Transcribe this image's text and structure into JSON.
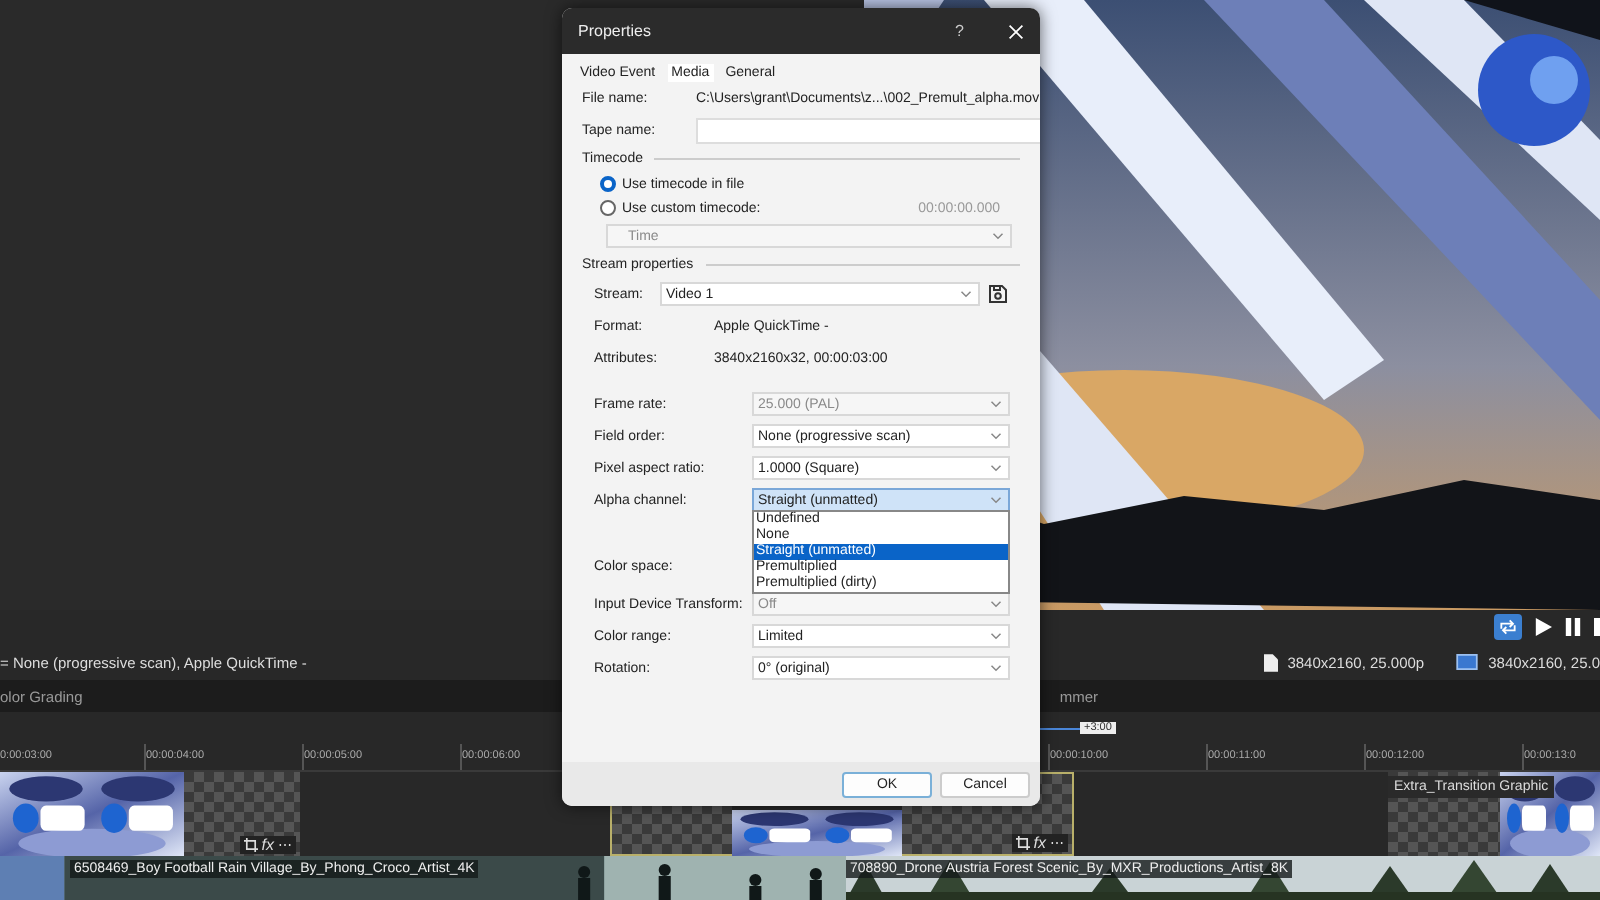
{
  "preview": {
    "kind": "picture"
  },
  "loop": {
    "on": true
  },
  "info": {
    "summary": "= None (progressive scan), Apple QuickTime -",
    "source": "3840x2160, 25.000p",
    "project": "3840x2160, 25.0"
  },
  "panel_tabs": [
    "olor Grading",
    "mmer"
  ],
  "zoom_tag": "+3:00",
  "ruler": {
    "before_dialog": [
      "0:00:03:00",
      "00:00:04:00",
      "00:00:05:00",
      "00:00:06:00"
    ],
    "after_dialog": [
      "00:00:10:00",
      "00:00:11:00",
      "00:00:12:00",
      "00:00:13:0"
    ]
  },
  "video_track": [
    {
      "selected": false,
      "tools": {
        "effects": "fx",
        "more": "⋯"
      }
    },
    {
      "selected": true,
      "tools": {
        "effects": "fx",
        "more": "⋯"
      }
    },
    {
      "selected": false,
      "label": "Extra_Transition Graphic"
    }
  ],
  "photo_track": [
    {
      "kind": "football",
      "label": "6508469_Boy Football Rain Village_By_Phong_Croco_Artist_4K"
    },
    {
      "kind": "forest",
      "label": "708890_Drone Austria Forest Scenic_By_MXR_Productions_Artist_8K"
    }
  ],
  "dialog": {
    "title": "Properties",
    "help": "?",
    "tabs": [
      {
        "label": "Video Event",
        "selected": false
      },
      {
        "label": "Media",
        "selected": true
      },
      {
        "label": "General",
        "selected": false
      }
    ],
    "file_name": {
      "label": "File name:",
      "value": "C:\\Users\\grant\\Documents\\z...\\002_Premult_alpha.mov"
    },
    "tape_name": {
      "label": "Tape name:"
    },
    "timecode": {
      "heading": "Timecode",
      "options": [
        {
          "label": "Use timecode in file",
          "selected": true
        },
        {
          "label": "Use custom timecode:",
          "selected": false
        }
      ],
      "custom_value": "00:00:00.000",
      "format": {
        "value": "Time",
        "disabled": true
      }
    },
    "stream": {
      "heading": "Stream properties",
      "label": "Stream:",
      "value": "Video 1",
      "format_label": "Format:",
      "format": "Apple QuickTime -",
      "attributes_label": "Attributes:",
      "attributes": "3840x2160x32, 00:00:03:00"
    },
    "fields": [
      {
        "label": "Frame rate:",
        "value": "25.000 (PAL)",
        "disabled": true
      },
      {
        "label": "Field order:",
        "value": "None (progressive scan)",
        "disabled": false
      },
      {
        "label": "Pixel aspect ratio:",
        "value": "1.0000 (Square)",
        "disabled": false
      },
      {
        "label": "Alpha channel:",
        "value": "Straight (unmatted)",
        "disabled": false,
        "options": [
          {
            "label": "Undefined",
            "selected": false
          },
          {
            "label": "None",
            "selected": false
          },
          {
            "label": "Straight (unmatted)",
            "selected": true
          },
          {
            "label": "Premultiplied",
            "selected": false
          },
          {
            "label": "Premultiplied (dirty)",
            "selected": false
          }
        ]
      },
      {
        "label": "Color space:"
      },
      {
        "label": "Input Device Transform:",
        "value": "Off",
        "disabled": true
      },
      {
        "label": "Color range:",
        "value": "Limited",
        "disabled": false
      },
      {
        "label": "Rotation:",
        "value": "0° (original)",
        "disabled": false
      }
    ],
    "buttons": [
      {
        "label": "OK",
        "default": true
      },
      {
        "label": "Cancel",
        "default": false
      }
    ]
  }
}
